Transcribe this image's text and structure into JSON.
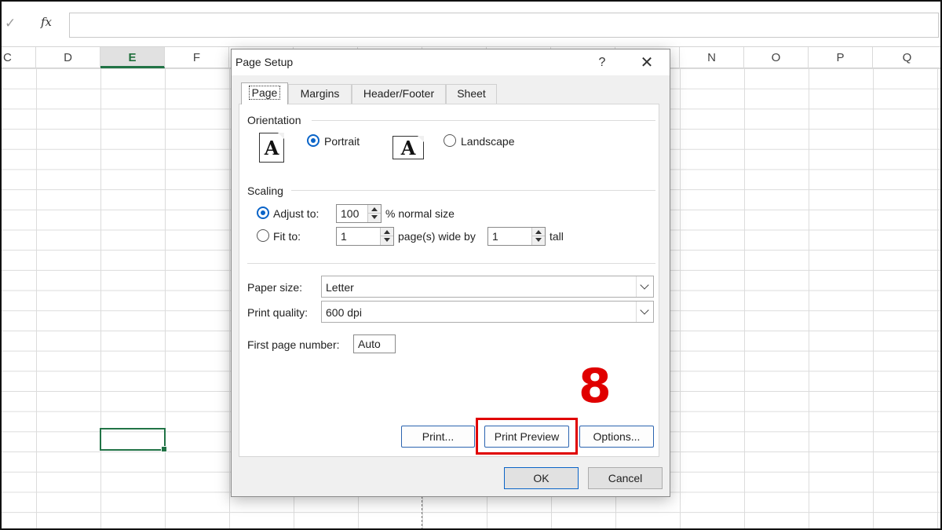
{
  "formula_bar": {
    "confirm_icon": "check-icon",
    "fx_label": "fx",
    "value": ""
  },
  "columns": [
    {
      "label": "C",
      "selected": false
    },
    {
      "label": "D",
      "selected": false
    },
    {
      "label": "E",
      "selected": true
    },
    {
      "label": "F",
      "selected": false
    },
    {
      "label": "N",
      "selected": false
    },
    {
      "label": "O",
      "selected": false
    },
    {
      "label": "P",
      "selected": false
    },
    {
      "label": "Q",
      "selected": false
    }
  ],
  "dialog": {
    "title": "Page Setup",
    "help_label": "?",
    "close_label": "✕",
    "tabs": [
      "Page",
      "Margins",
      "Header/Footer",
      "Sheet"
    ],
    "active_tab": "Page",
    "orientation": {
      "label": "Orientation",
      "portrait_label": "Portrait",
      "landscape_label": "Landscape",
      "icon_glyph": "A",
      "selected": "portrait"
    },
    "scaling": {
      "label": "Scaling",
      "adjust_to_label": "Adjust to:",
      "adjust_value": "100",
      "adjust_suffix": "% normal size",
      "fit_to_label": "Fit to:",
      "fit_wide_value": "1",
      "fit_wide_suffix": "page(s) wide by",
      "fit_tall_value": "1",
      "fit_tall_suffix": "tall",
      "selected": "adjust"
    },
    "paper_size": {
      "label": "Paper size:",
      "value": "Letter"
    },
    "print_quality": {
      "label": "Print quality:",
      "value": "600 dpi"
    },
    "first_page_number": {
      "label": "First page number:",
      "value": "Auto"
    },
    "buttons": {
      "print": "Print...",
      "print_preview": "Print Preview",
      "options": "Options...",
      "ok": "OK",
      "cancel": "Cancel"
    }
  },
  "annotation": {
    "step_number": "8",
    "color": "#e00000"
  },
  "colors": {
    "excel_green": "#217346",
    "radio_blue": "#0a64c8"
  }
}
